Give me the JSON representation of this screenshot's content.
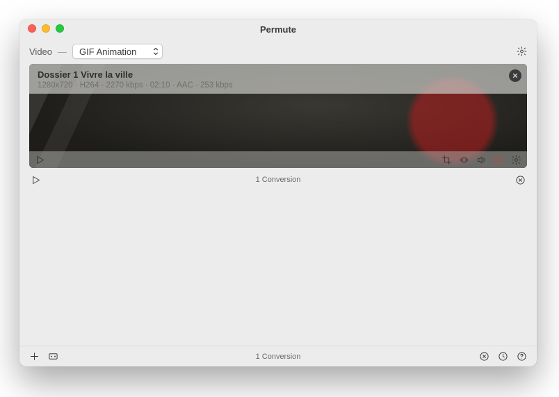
{
  "window": {
    "title": "Permute"
  },
  "toolbar": {
    "kind_label": "Video",
    "dash": "—",
    "preset_selected": "GIF Animation"
  },
  "item": {
    "name": "Dossier 1 Vivre la ville",
    "meta": "1280x720 · H264 · 2270 kbps · 02:10 · AAC · 253 kbps"
  },
  "status": {
    "text": "1 Conversion"
  },
  "bottom": {
    "text": "1 Conversion"
  }
}
